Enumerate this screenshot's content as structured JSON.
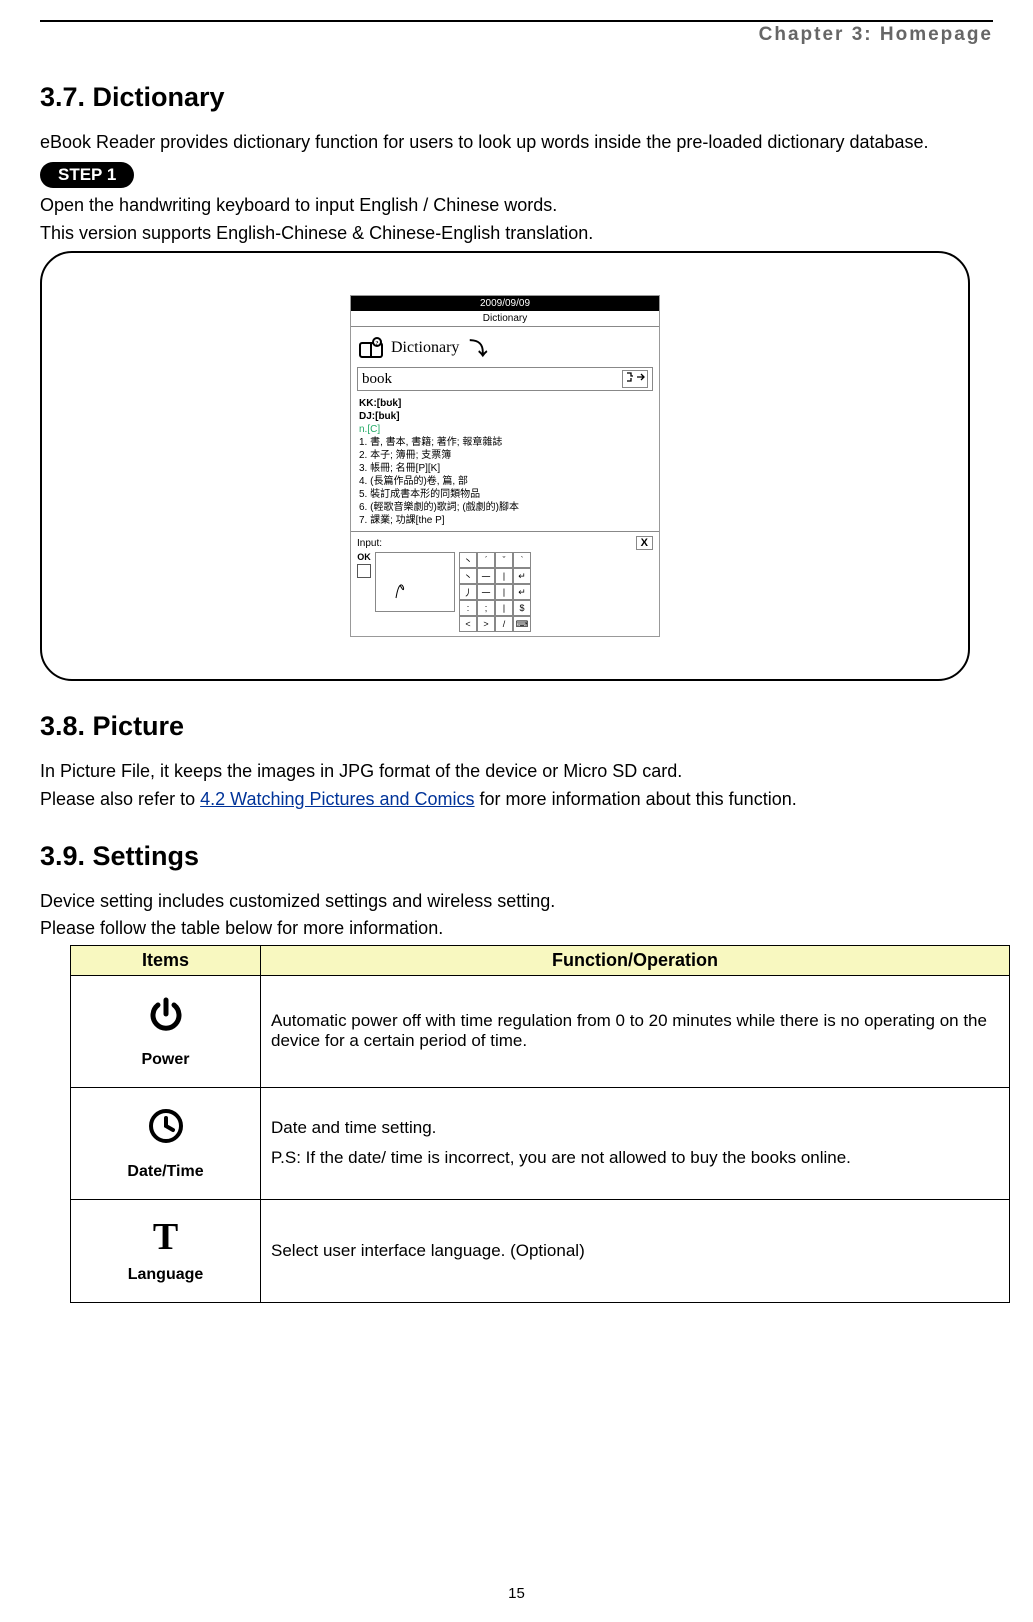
{
  "chapter_header": "Chapter 3: Homepage",
  "sections": {
    "s37": {
      "title": "3.7. Dictionary",
      "intro": "eBook Reader provides dictionary function for users to look up words inside the pre-loaded dictionary database.",
      "step_label": "STEP 1",
      "step_line1": "Open the handwriting keyboard to input English / Chinese words.",
      "step_line2": "This version supports English-Chinese & Chinese-English translation."
    },
    "s38": {
      "title": "3.8.  Picture",
      "line1_pre": "In Picture File, it keeps the images in JPG format of the device or Micro SD card.",
      "line2_pre": "Please also refer to ",
      "line2_link": "4.2 Watching Pictures and Comics",
      "line2_post": " for more information about this function."
    },
    "s39": {
      "title": "3.9.  Settings",
      "line1": "Device setting includes customized settings and wireless setting.",
      "line2": "Please follow the table below for more information."
    }
  },
  "device": {
    "date": "2009/09/09",
    "mode": "Dictionary",
    "title": "Dictionary",
    "search_word": "book",
    "kk": "KK:[bʊk]",
    "dj": "DJ:[buk]",
    "pos": "n.[C]",
    "defs": [
      "1. 書, 書本, 書籍; 著作; 報章雜誌",
      "2. 本子; 簿冊; 支票簿",
      "3. 帳冊; 名冊[P][K]",
      "4. (長篇作品的)卷, 篇, 部",
      "5. 裝訂成書本形的同類物品",
      "6. (輕歌音樂劇的)歌詞; (戲劇的)腳本",
      "7. 課業; 功課[the P]"
    ],
    "input_label": "Input:",
    "ok_label": "OK",
    "close_label": "X"
  },
  "table": {
    "head_items": "Items",
    "head_func": "Function/Operation",
    "rows": [
      {
        "icon": "⏻",
        "label": "Power",
        "desc": "Automatic power off with time regulation from 0 to 20 minutes while there is no operating on the device for a certain period of time."
      },
      {
        "icon": "🕒",
        "label": "Date/Time",
        "desc_line1": "Date and time setting.",
        "desc_line2": "P.S: If the date/ time is incorrect, you are not allowed to buy the books online."
      },
      {
        "icon": "T",
        "label": "Language",
        "desc": "Select user interface language. (Optional)"
      }
    ]
  },
  "page_number": "15"
}
